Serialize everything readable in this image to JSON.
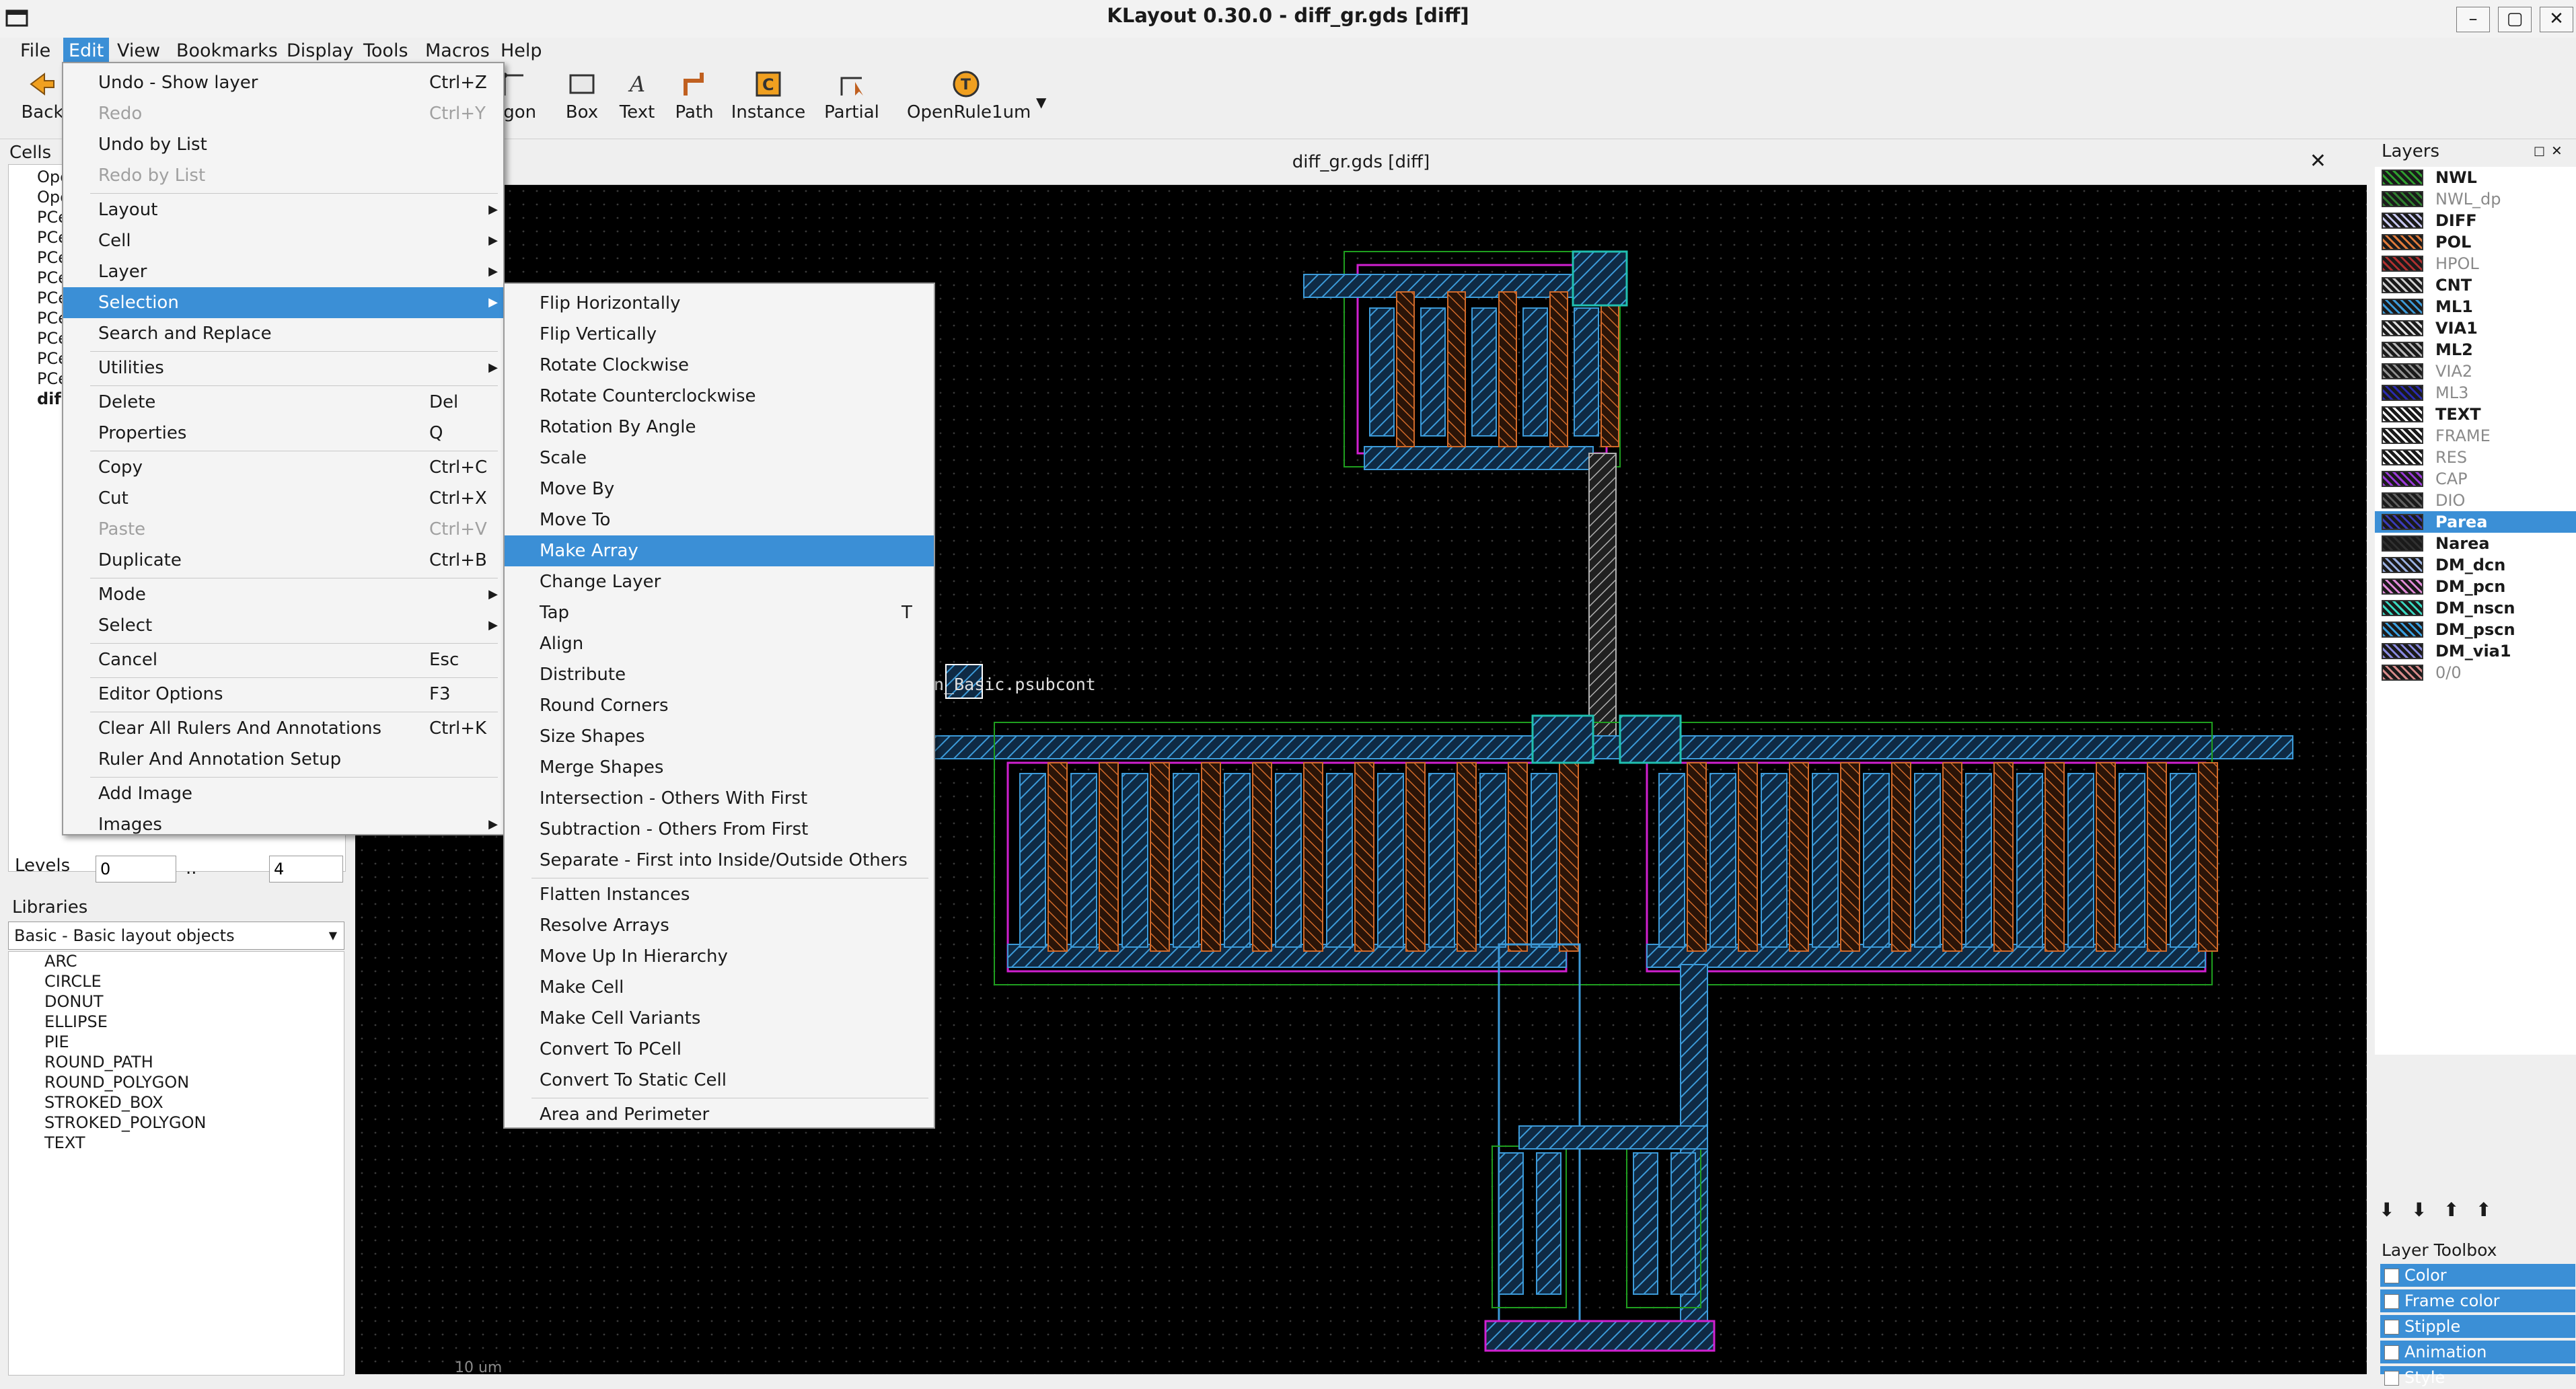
{
  "window": {
    "title": "KLayout 0.30.0 - diff_gr.gds [diff]"
  },
  "menubar": [
    "File",
    "Edit",
    "View",
    "Bookmarks",
    "Display",
    "Tools",
    "Macros",
    "Help"
  ],
  "toolbar": {
    "back": "Back",
    "polygon": "ygon",
    "box": "Box",
    "text": "Text",
    "path": "Path",
    "instance": "Instance",
    "partial": "Partial",
    "openrule": "OpenRule1um"
  },
  "cells": {
    "header": "Cells",
    "items": [
      "Ope",
      "Ope",
      "PCe",
      "PCe",
      "PCe",
      "PCe",
      "PCe",
      "PCe",
      "PCe",
      "PCe",
      "PCe",
      "dif"
    ]
  },
  "levels": {
    "label": "Levels",
    "from": "0",
    "sep": "..",
    "to": "4"
  },
  "libraries": {
    "header": "Libraries",
    "selected": "Basic - Basic layout objects",
    "items": [
      "ARC",
      "CIRCLE",
      "DONUT",
      "ELLIPSE",
      "PIE",
      "ROUND_PATH",
      "ROUND_POLYGON",
      "STROKED_BOX",
      "STROKED_POLYGON",
      "TEXT"
    ]
  },
  "canvas": {
    "title": "diff_gr.gds [diff]",
    "label": "n_Basic.psubcont",
    "scale": "10 um"
  },
  "layers": {
    "header": "Layers",
    "items": [
      {
        "name": "NWL",
        "color": "#2f9f2f",
        "dim": false
      },
      {
        "name": "NWL_dp",
        "color": "#2f7f2f",
        "dim": true
      },
      {
        "name": "DIFF",
        "color": "#c8c8f0",
        "dim": false
      },
      {
        "name": "POL",
        "color": "#e07a3a",
        "dim": false
      },
      {
        "name": "HPOL",
        "color": "#b03030",
        "dim": true
      },
      {
        "name": "CNT",
        "color": "#d0d0d0",
        "dim": false
      },
      {
        "name": "ML1",
        "color": "#3c9ad8",
        "dim": false
      },
      {
        "name": "VIA1",
        "color": "#e0e0e0",
        "dim": false
      },
      {
        "name": "ML2",
        "color": "#b8b8b8",
        "dim": false
      },
      {
        "name": "VIA2",
        "color": "#909090",
        "dim": true
      },
      {
        "name": "ML3",
        "color": "#2a2ab0",
        "dim": true
      },
      {
        "name": "TEXT",
        "color": "#ffffff",
        "dim": false
      },
      {
        "name": "FRAME",
        "color": "#ffffff",
        "dim": true
      },
      {
        "name": "RES",
        "color": "#ffffff",
        "dim": true
      },
      {
        "name": "CAP",
        "color": "#9a3ad8",
        "dim": true
      },
      {
        "name": "DIO",
        "color": "#606060",
        "dim": true
      },
      {
        "name": "Parea",
        "color": "#3a3ab8",
        "dim": false
      },
      {
        "name": "Narea",
        "color": "#303030",
        "dim": false
      },
      {
        "name": "DM_dcn",
        "color": "#9ab0e0",
        "dim": false
      },
      {
        "name": "DM_pcn",
        "color": "#e08ad8",
        "dim": false
      },
      {
        "name": "DM_nscn",
        "color": "#3ad8c0",
        "dim": false
      },
      {
        "name": "DM_pscn",
        "color": "#3aa0e0",
        "dim": false
      },
      {
        "name": "DM_via1",
        "color": "#8a8ae0",
        "dim": false
      },
      {
        "name": "0/0",
        "color": "#d88a8a",
        "dim": true
      }
    ],
    "selected": "Parea"
  },
  "layer_toolbox": {
    "header": "Layer Toolbox",
    "items": [
      "Color",
      "Frame color",
      "Stipple",
      "Animation",
      "Style"
    ]
  },
  "edit_menu": [
    {
      "label": "Undo - Show layer",
      "shortcut": "Ctrl+Z"
    },
    {
      "label": "Redo",
      "shortcut": "Ctrl+Y",
      "disabled": true
    },
    {
      "label": "Undo by List"
    },
    {
      "label": "Redo by List",
      "disabled": true
    },
    {
      "sep": true
    },
    {
      "label": "Layout",
      "sub": true
    },
    {
      "label": "Cell",
      "sub": true
    },
    {
      "label": "Layer",
      "sub": true
    },
    {
      "label": "Selection",
      "sub": true,
      "hl": true
    },
    {
      "label": "Search and Replace"
    },
    {
      "sep": true
    },
    {
      "label": "Utilities",
      "sub": true
    },
    {
      "sep": true
    },
    {
      "label": "Delete",
      "shortcut": "Del"
    },
    {
      "label": "Properties",
      "shortcut": "Q"
    },
    {
      "sep": true
    },
    {
      "label": "Copy",
      "shortcut": "Ctrl+C"
    },
    {
      "label": "Cut",
      "shortcut": "Ctrl+X"
    },
    {
      "label": "Paste",
      "shortcut": "Ctrl+V",
      "disabled": true
    },
    {
      "label": "Duplicate",
      "shortcut": "Ctrl+B"
    },
    {
      "sep": true
    },
    {
      "label": "Mode",
      "sub": true
    },
    {
      "label": "Select",
      "sub": true
    },
    {
      "sep": true
    },
    {
      "label": "Cancel",
      "shortcut": "Esc"
    },
    {
      "sep": true
    },
    {
      "label": "Editor Options",
      "shortcut": "F3"
    },
    {
      "sep": true
    },
    {
      "label": "Clear All Rulers And Annotations",
      "shortcut": "Ctrl+K"
    },
    {
      "label": "Ruler And Annotation Setup"
    },
    {
      "sep": true
    },
    {
      "label": "Add Image"
    },
    {
      "label": "Images",
      "sub": true
    }
  ],
  "selection_menu": [
    {
      "label": "Flip Horizontally"
    },
    {
      "label": "Flip Vertically"
    },
    {
      "label": "Rotate Clockwise"
    },
    {
      "label": "Rotate Counterclockwise"
    },
    {
      "label": "Rotation By Angle"
    },
    {
      "label": "Scale"
    },
    {
      "label": "Move By"
    },
    {
      "label": "Move To"
    },
    {
      "label": "Make Array",
      "hl": true
    },
    {
      "label": "Change Layer"
    },
    {
      "label": "Tap",
      "shortcut": "T"
    },
    {
      "label": "Align"
    },
    {
      "label": "Distribute"
    },
    {
      "label": "Round Corners"
    },
    {
      "label": "Size Shapes"
    },
    {
      "label": "Merge Shapes"
    },
    {
      "label": "Intersection - Others With First"
    },
    {
      "label": "Subtraction - Others From First"
    },
    {
      "label": "Separate - First into Inside/Outside Others"
    },
    {
      "sep": true
    },
    {
      "label": "Flatten Instances"
    },
    {
      "label": "Resolve Arrays"
    },
    {
      "label": "Move Up In Hierarchy"
    },
    {
      "label": "Make Cell"
    },
    {
      "label": "Make Cell Variants"
    },
    {
      "label": "Convert To PCell"
    },
    {
      "label": "Convert To Static Cell"
    },
    {
      "sep": true
    },
    {
      "label": "Area and Perimeter"
    }
  ]
}
